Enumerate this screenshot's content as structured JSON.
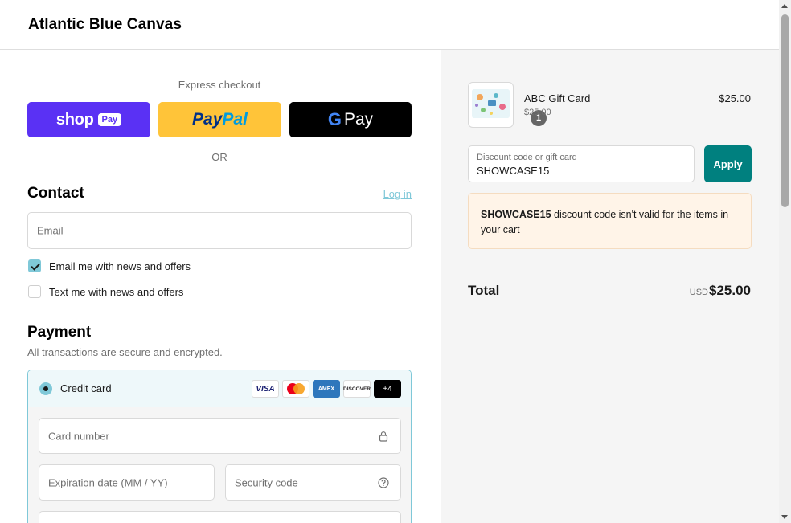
{
  "header": {
    "store_name": "Atlantic Blue Canvas"
  },
  "express": {
    "label": "Express checkout",
    "shop_text": "shop",
    "shop_pill": "Pay",
    "paypal_a": "Pay",
    "paypal_b": "Pal",
    "gpay_g": "G",
    "gpay_text": "Pay",
    "or": "OR"
  },
  "contact": {
    "title": "Contact",
    "login": "Log in",
    "email_placeholder": "Email",
    "email_news": "Email me with news and offers",
    "email_news_checked": true,
    "text_news": "Text me with news and offers",
    "text_news_checked": false
  },
  "payment": {
    "title": "Payment",
    "subtitle": "All transactions are secure and encrypted.",
    "method_label": "Credit card",
    "brands": [
      "VISA",
      "AMEX",
      "DISCOVER",
      "+4"
    ],
    "card_number_placeholder": "Card number",
    "expiry_placeholder": "Expiration date (MM / YY)",
    "security_placeholder": "Security code"
  },
  "summary": {
    "quantity": "1",
    "product_name": "ABC Gift Card",
    "product_sub": "$25.00",
    "product_price": "$25.00",
    "discount_label": "Discount code or gift card",
    "discount_value": "SHOWCASE15",
    "apply_label": "Apply",
    "warning_code": "SHOWCASE15",
    "warning_text": " discount code isn't valid for the items in your cart",
    "total_label": "Total",
    "currency": "USD",
    "total_value": "$25.00"
  },
  "colors": {
    "accent": "#7fc8d8",
    "apply_button": "#00807f",
    "shop_pay": "#5a31f4",
    "paypal": "#ffc439"
  }
}
